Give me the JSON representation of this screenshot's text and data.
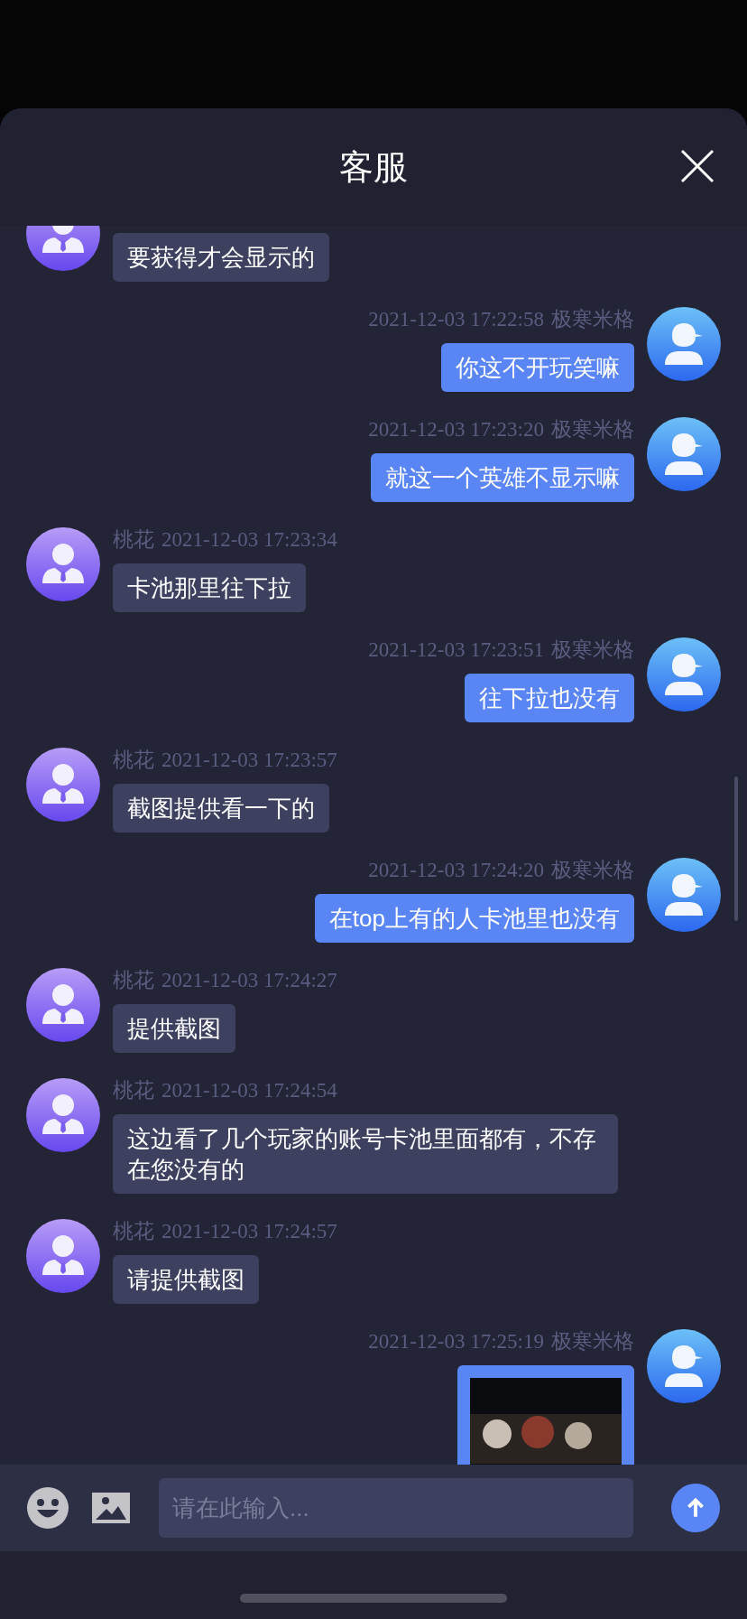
{
  "header": {
    "title": "客服"
  },
  "messages": [
    {
      "outgoing": false,
      "kind": "text",
      "text": "要获得才会显示的"
    },
    {
      "outgoing": true,
      "kind": "text",
      "sender": "极寒米格",
      "time": "2021-12-03 17:22:58",
      "text": "你这不开玩笑嘛"
    },
    {
      "outgoing": true,
      "kind": "text",
      "sender": "极寒米格",
      "time": "2021-12-03 17:23:20",
      "text": "就这一个英雄不显示嘛"
    },
    {
      "outgoing": false,
      "kind": "text",
      "sender": "桃花",
      "time": "2021-12-03 17:23:34",
      "text": "卡池那里往下拉"
    },
    {
      "outgoing": true,
      "kind": "text",
      "sender": "极寒米格",
      "time": "2021-12-03 17:23:51",
      "text": "往下拉也没有"
    },
    {
      "outgoing": false,
      "kind": "text",
      "sender": "桃花",
      "time": "2021-12-03 17:23:57",
      "text": "截图提供看一下的"
    },
    {
      "outgoing": true,
      "kind": "text",
      "sender": "极寒米格",
      "time": "2021-12-03 17:24:20",
      "text": "在top上有的人卡池里也没有"
    },
    {
      "outgoing": false,
      "kind": "text",
      "sender": "桃花",
      "time": "2021-12-03 17:24:27",
      "text": "提供截图"
    },
    {
      "outgoing": false,
      "kind": "text",
      "sender": "桃花",
      "time": "2021-12-03 17:24:54",
      "text": "这边看了几个玩家的账号卡池里面都有，不存在您没有的"
    },
    {
      "outgoing": false,
      "kind": "text",
      "sender": "桃花",
      "time": "2021-12-03 17:24:57",
      "text": "请提供截图"
    },
    {
      "outgoing": true,
      "sender": "极寒米格",
      "time": "2021-12-03 17:25:19"
    }
  ],
  "input": {
    "placeholder": "请在此输入..."
  }
}
